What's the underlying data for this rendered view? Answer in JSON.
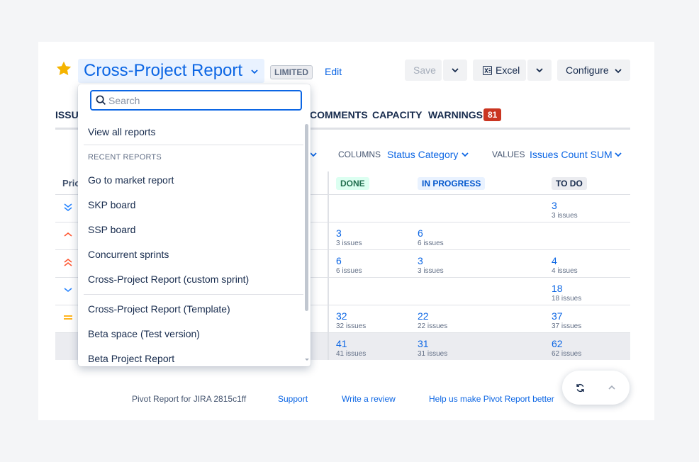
{
  "header": {
    "title": "Cross-Project Report",
    "badge": "LIMITED",
    "edit_label": "Edit",
    "save_label": "Save",
    "excel_label": "Excel",
    "configure_label": "Configure"
  },
  "tabs": [
    {
      "label": "ISSUE"
    },
    {
      "label": "COMMENTS"
    },
    {
      "label": "CAPACITY"
    },
    {
      "label": "WARNINGS",
      "count": "81"
    }
  ],
  "options": {
    "columns_label": "COLUMNS",
    "columns_value": "Status Category",
    "values_label": "VALUES",
    "values_value": "Issues Count SUM"
  },
  "table": {
    "first_header": "Prio",
    "columns": [
      "DONE",
      "IN PROGRESS",
      "TO DO"
    ],
    "rows": [
      {
        "priority_icon": "lowest-priority-icon",
        "cells": [
          null,
          null,
          {
            "value": "3",
            "sub": "3 issues"
          }
        ]
      },
      {
        "priority_icon": "medium-priority-icon",
        "cells": [
          {
            "value": "3",
            "sub": "3 issues"
          },
          {
            "value": "6",
            "sub": "6 issues"
          },
          null
        ]
      },
      {
        "priority_icon": "high-priority-icon",
        "cells": [
          {
            "value": "6",
            "sub": "6 issues"
          },
          {
            "value": "3",
            "sub": "3 issues"
          },
          {
            "value": "4",
            "sub": "4 issues"
          }
        ]
      },
      {
        "priority_icon": "low-priority-icon",
        "cells": [
          null,
          null,
          {
            "value": "18",
            "sub": "18 issues"
          }
        ]
      },
      {
        "priority_icon": "equal-priority-icon",
        "cells": [
          {
            "value": "32",
            "sub": "32 issues"
          },
          {
            "value": "22",
            "sub": "22 issues"
          },
          {
            "value": "37",
            "sub": "37 issues"
          }
        ]
      },
      {
        "priority_icon": null,
        "cells": [
          {
            "value": "41",
            "sub": "41 issues"
          },
          {
            "value": "31",
            "sub": "31 issues"
          },
          {
            "value": "62",
            "sub": "62 issues"
          }
        ]
      }
    ]
  },
  "dropdown": {
    "search_placeholder": "Search",
    "view_all": "View all reports",
    "recent_heading": "RECENT REPORTS",
    "recent": [
      "Go to market report",
      "SKP board",
      "SSP board",
      "Concurrent sprints",
      "Cross-Project Report (custom sprint)"
    ],
    "others": [
      "Cross-Project Report (Template)",
      "Beta space (Test version)",
      "Beta Project Report"
    ]
  },
  "footer": {
    "version": "Pivot Report for JIRA 2815c1ff",
    "support": "Support",
    "review": "Write a review",
    "help": "Help us make Pivot Report better"
  },
  "colors": {
    "accent": "#0c66e4",
    "star": "#f5b400",
    "warning_badge": "#ca3521",
    "done_lozenge": "#dcfff1",
    "in_progress_lozenge": "#e9f2ff",
    "todo_lozenge": "#ebecf0"
  }
}
